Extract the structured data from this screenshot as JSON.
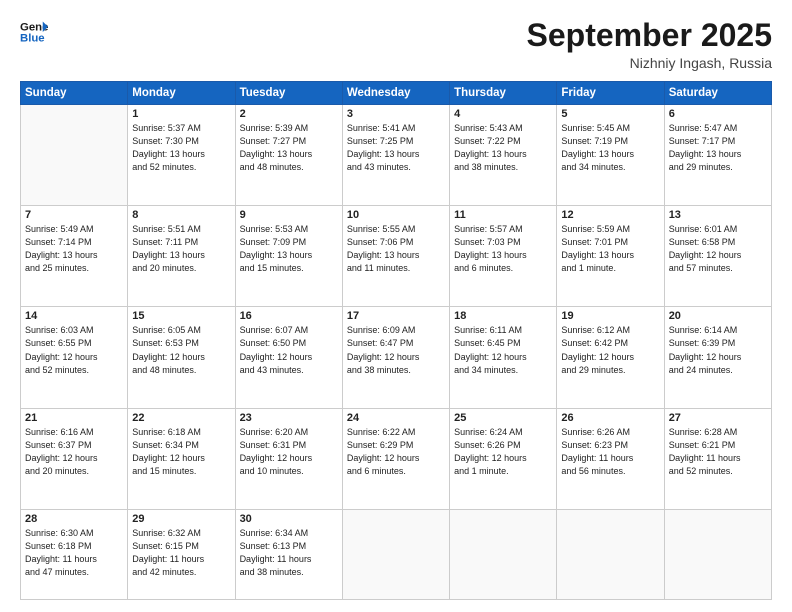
{
  "header": {
    "logo_line1": "General",
    "logo_line2": "Blue",
    "month": "September 2025",
    "location": "Nizhniy Ingash, Russia"
  },
  "days_of_week": [
    "Sunday",
    "Monday",
    "Tuesday",
    "Wednesday",
    "Thursday",
    "Friday",
    "Saturday"
  ],
  "weeks": [
    [
      {
        "day": "",
        "text": ""
      },
      {
        "day": "1",
        "text": "Sunrise: 5:37 AM\nSunset: 7:30 PM\nDaylight: 13 hours\nand 52 minutes."
      },
      {
        "day": "2",
        "text": "Sunrise: 5:39 AM\nSunset: 7:27 PM\nDaylight: 13 hours\nand 48 minutes."
      },
      {
        "day": "3",
        "text": "Sunrise: 5:41 AM\nSunset: 7:25 PM\nDaylight: 13 hours\nand 43 minutes."
      },
      {
        "day": "4",
        "text": "Sunrise: 5:43 AM\nSunset: 7:22 PM\nDaylight: 13 hours\nand 38 minutes."
      },
      {
        "day": "5",
        "text": "Sunrise: 5:45 AM\nSunset: 7:19 PM\nDaylight: 13 hours\nand 34 minutes."
      },
      {
        "day": "6",
        "text": "Sunrise: 5:47 AM\nSunset: 7:17 PM\nDaylight: 13 hours\nand 29 minutes."
      }
    ],
    [
      {
        "day": "7",
        "text": "Sunrise: 5:49 AM\nSunset: 7:14 PM\nDaylight: 13 hours\nand 25 minutes."
      },
      {
        "day": "8",
        "text": "Sunrise: 5:51 AM\nSunset: 7:11 PM\nDaylight: 13 hours\nand 20 minutes."
      },
      {
        "day": "9",
        "text": "Sunrise: 5:53 AM\nSunset: 7:09 PM\nDaylight: 13 hours\nand 15 minutes."
      },
      {
        "day": "10",
        "text": "Sunrise: 5:55 AM\nSunset: 7:06 PM\nDaylight: 13 hours\nand 11 minutes."
      },
      {
        "day": "11",
        "text": "Sunrise: 5:57 AM\nSunset: 7:03 PM\nDaylight: 13 hours\nand 6 minutes."
      },
      {
        "day": "12",
        "text": "Sunrise: 5:59 AM\nSunset: 7:01 PM\nDaylight: 13 hours\nand 1 minute."
      },
      {
        "day": "13",
        "text": "Sunrise: 6:01 AM\nSunset: 6:58 PM\nDaylight: 12 hours\nand 57 minutes."
      }
    ],
    [
      {
        "day": "14",
        "text": "Sunrise: 6:03 AM\nSunset: 6:55 PM\nDaylight: 12 hours\nand 52 minutes."
      },
      {
        "day": "15",
        "text": "Sunrise: 6:05 AM\nSunset: 6:53 PM\nDaylight: 12 hours\nand 48 minutes."
      },
      {
        "day": "16",
        "text": "Sunrise: 6:07 AM\nSunset: 6:50 PM\nDaylight: 12 hours\nand 43 minutes."
      },
      {
        "day": "17",
        "text": "Sunrise: 6:09 AM\nSunset: 6:47 PM\nDaylight: 12 hours\nand 38 minutes."
      },
      {
        "day": "18",
        "text": "Sunrise: 6:11 AM\nSunset: 6:45 PM\nDaylight: 12 hours\nand 34 minutes."
      },
      {
        "day": "19",
        "text": "Sunrise: 6:12 AM\nSunset: 6:42 PM\nDaylight: 12 hours\nand 29 minutes."
      },
      {
        "day": "20",
        "text": "Sunrise: 6:14 AM\nSunset: 6:39 PM\nDaylight: 12 hours\nand 24 minutes."
      }
    ],
    [
      {
        "day": "21",
        "text": "Sunrise: 6:16 AM\nSunset: 6:37 PM\nDaylight: 12 hours\nand 20 minutes."
      },
      {
        "day": "22",
        "text": "Sunrise: 6:18 AM\nSunset: 6:34 PM\nDaylight: 12 hours\nand 15 minutes."
      },
      {
        "day": "23",
        "text": "Sunrise: 6:20 AM\nSunset: 6:31 PM\nDaylight: 12 hours\nand 10 minutes."
      },
      {
        "day": "24",
        "text": "Sunrise: 6:22 AM\nSunset: 6:29 PM\nDaylight: 12 hours\nand 6 minutes."
      },
      {
        "day": "25",
        "text": "Sunrise: 6:24 AM\nSunset: 6:26 PM\nDaylight: 12 hours\nand 1 minute."
      },
      {
        "day": "26",
        "text": "Sunrise: 6:26 AM\nSunset: 6:23 PM\nDaylight: 11 hours\nand 56 minutes."
      },
      {
        "day": "27",
        "text": "Sunrise: 6:28 AM\nSunset: 6:21 PM\nDaylight: 11 hours\nand 52 minutes."
      }
    ],
    [
      {
        "day": "28",
        "text": "Sunrise: 6:30 AM\nSunset: 6:18 PM\nDaylight: 11 hours\nand 47 minutes."
      },
      {
        "day": "29",
        "text": "Sunrise: 6:32 AM\nSunset: 6:15 PM\nDaylight: 11 hours\nand 42 minutes."
      },
      {
        "day": "30",
        "text": "Sunrise: 6:34 AM\nSunset: 6:13 PM\nDaylight: 11 hours\nand 38 minutes."
      },
      {
        "day": "",
        "text": ""
      },
      {
        "day": "",
        "text": ""
      },
      {
        "day": "",
        "text": ""
      },
      {
        "day": "",
        "text": ""
      }
    ]
  ]
}
